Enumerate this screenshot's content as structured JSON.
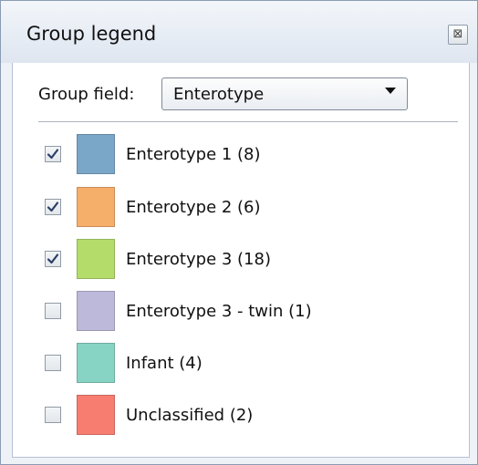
{
  "window": {
    "title": "Group legend",
    "close_glyph": "⊠"
  },
  "group_field": {
    "label": "Group field:",
    "selected": "Enterotype"
  },
  "legend": {
    "items": [
      {
        "label": "Enterotype 1 (8)",
        "checked": true,
        "color": "#7aa6c8"
      },
      {
        "label": "Enterotype 2 (6)",
        "checked": true,
        "color": "#f6ae6b"
      },
      {
        "label": "Enterotype 3 (18)",
        "checked": true,
        "color": "#b3dc6a"
      },
      {
        "label": "Enterotype 3 - twin (1)",
        "checked": false,
        "color": "#bdb9da"
      },
      {
        "label": "Infant (4)",
        "checked": false,
        "color": "#87d3c4"
      },
      {
        "label": "Unclassified (2)",
        "checked": false,
        "color": "#f77d71"
      }
    ]
  }
}
